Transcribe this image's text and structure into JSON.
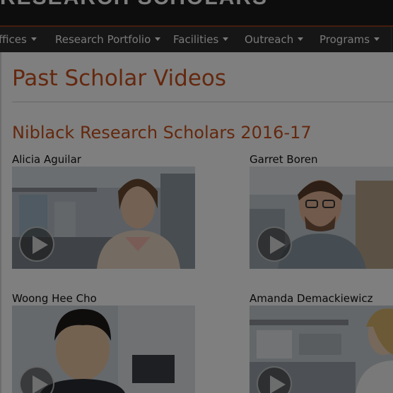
{
  "header": {
    "site_title": "RESEARCH SCHOLARS"
  },
  "nav": {
    "items": [
      {
        "label": "ffices"
      },
      {
        "label": "Research Portfolio"
      },
      {
        "label": "Facilities"
      },
      {
        "label": "Outreach"
      },
      {
        "label": "Programs"
      }
    ]
  },
  "main": {
    "page_title": "Past Scholar Videos",
    "section_title": "Niblack Research Scholars 2016-17",
    "scholars": [
      {
        "name": "Alicia Aguilar"
      },
      {
        "name": "Garret Boren"
      },
      {
        "name": "Woong Hee Cho"
      },
      {
        "name": "Amanda Demackiewicz"
      }
    ]
  },
  "colors": {
    "accent": "#c8511c",
    "header_bg": "#1a1a1a",
    "nav_bg": "#2c2c2c",
    "overlay": "rgba(0,0,0,0.5)"
  },
  "icons": [
    "play-icon",
    "caret-down-icon"
  ]
}
